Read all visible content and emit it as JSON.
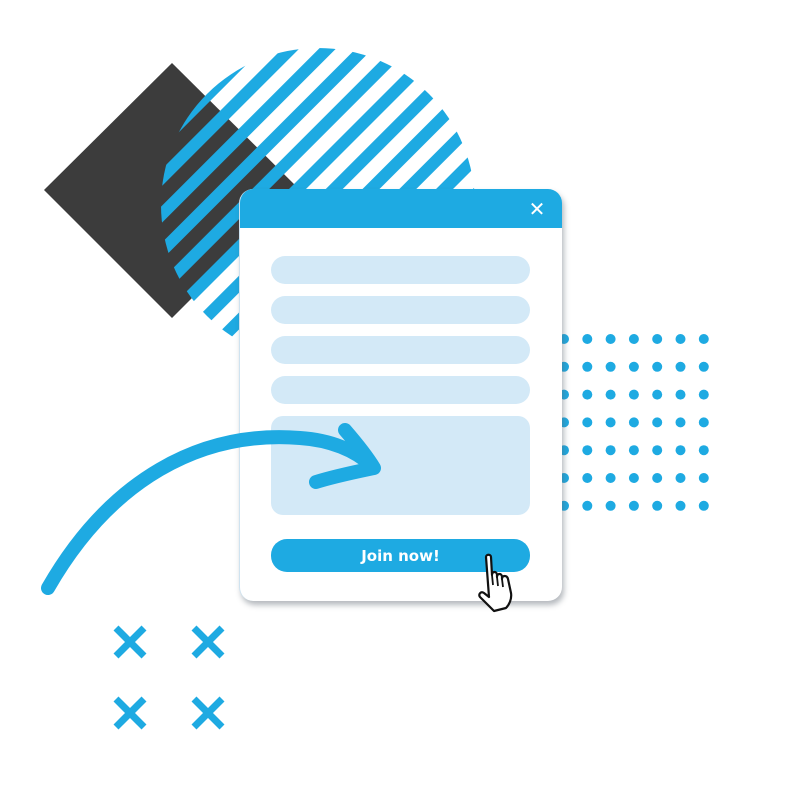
{
  "popup": {
    "close_icon": "✕",
    "fields": [
      {
        "name": "field-1",
        "value": "",
        "placeholder": ""
      },
      {
        "name": "field-2",
        "value": "",
        "placeholder": ""
      },
      {
        "name": "field-3",
        "value": "",
        "placeholder": ""
      },
      {
        "name": "field-4",
        "value": "",
        "placeholder": ""
      }
    ],
    "message": {
      "value": "",
      "placeholder": ""
    },
    "join_button_label": "Join now!"
  },
  "decor": {
    "icons": [
      "striped-circle",
      "dark-diamond",
      "dot-grid",
      "curved-arrow",
      "x-marks",
      "hand-cursor"
    ],
    "dot_grid": {
      "rows": 7,
      "cols": 7
    },
    "x_marks_count": 4
  },
  "colors": {
    "accent": "#1eaae2",
    "field_fill": "#d3e9f7",
    "dark_shape": "#3c3c3c",
    "background": "#ffffff"
  }
}
